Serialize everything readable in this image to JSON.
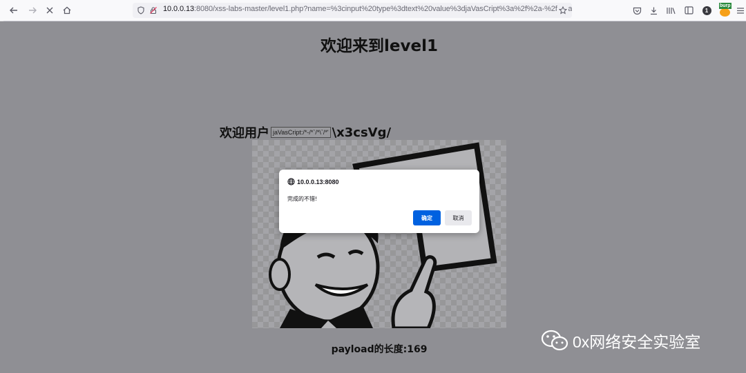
{
  "browser": {
    "url_host": "10.0.0.13",
    "url_rest": ":8080/xss-labs-master/level1.php?name=%3cinput%20type%3dtext%20value%3djaVasCript%3a%2f%2a-%2f%2a",
    "extension_badge": "burp",
    "notification_badge": "1"
  },
  "page": {
    "title": "欢迎来到level1",
    "welcome_prefix": "欢迎用户",
    "input_value": "jaVasCript:/*-/*`/*\\`/*'",
    "welcome_suffix": "\\x3csVg/",
    "payload_length": "payload的长度:169"
  },
  "dialog": {
    "origin": "10.0.0.13:8080",
    "message": "完成的不错!",
    "ok_label": "确定",
    "cancel_label": "取消"
  },
  "watermark": {
    "text": "0x网络安全实验室"
  },
  "colors": {
    "accent": "#0061e0",
    "page_bg_dimmed": "#8f8f94"
  }
}
